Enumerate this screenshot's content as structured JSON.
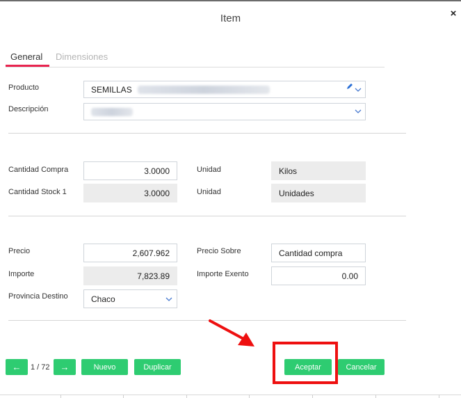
{
  "dialog": {
    "title": "Item",
    "close_label": "×"
  },
  "tabs": [
    {
      "label": "General",
      "active": true
    },
    {
      "label": "Dimensiones",
      "active": false
    }
  ],
  "producto": {
    "label": "Producto",
    "value": "SEMILLAS"
  },
  "descripcion": {
    "label": "Descripción"
  },
  "cantidad_compra": {
    "label": "Cantidad Compra",
    "value": "3.0000",
    "unit_label": "Unidad",
    "unit_value": "Kilos"
  },
  "cantidad_stock": {
    "label": "Cantidad Stock 1",
    "value": "3.0000",
    "unit_label": "Unidad",
    "unit_value": "Unidades"
  },
  "precio": {
    "label": "Precio",
    "value": "2,607.962",
    "sobre_label": "Precio Sobre",
    "sobre_value": "Cantidad compra"
  },
  "importe": {
    "label": "Importe",
    "value": "7,823.89",
    "exento_label": "Importe Exento",
    "exento_value": "0.00"
  },
  "provincia": {
    "label": "Provincia Destino",
    "value": "Chaco"
  },
  "footer": {
    "prev_label": "←",
    "pager": "1 / 72",
    "next_label": "→",
    "nuevo": "Nuevo",
    "duplicar": "Duplicar",
    "aceptar": "Aceptar",
    "cancelar": "Cancelar"
  },
  "colors": {
    "accent": "#e8244f",
    "button": "#2ecc71",
    "highlight": "#ee1010"
  },
  "icons": [
    "close-icon",
    "pencil-icon",
    "chevron-down-icon",
    "arrow-left-icon",
    "arrow-right-icon"
  ]
}
